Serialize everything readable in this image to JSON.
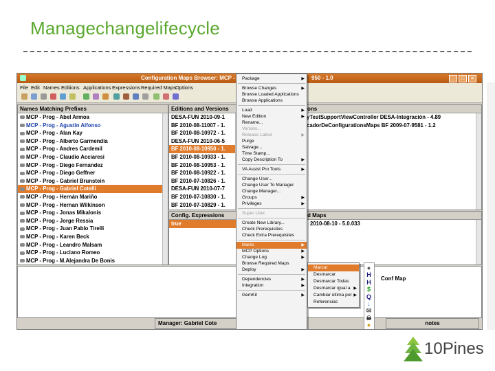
{
  "slide": {
    "title": "Managechangelifecycle"
  },
  "window": {
    "title_left": "Configuration Maps Browser: MCP - Pro",
    "title_right": "950 - 1.0",
    "controls": [
      "_",
      "□",
      "×"
    ]
  },
  "menubar": [
    "File",
    "Edit",
    "Names",
    "Editions",
    "Applications",
    "Expressions",
    "Required Maps",
    "Options"
  ],
  "names_pane": {
    "header": "Names Matching Prefixes",
    "rows": [
      "MCP - Prog - Abel Armoa",
      "MCP - Prog - Agustin Alfonso",
      "MCP - Prog - Alan Kay",
      "MCP - Prog - Alberto Garmendia",
      "MCP - Prog - Andres Cardemil",
      "MCP - Prog - Claudio Acciaresi",
      "MCP - Prog - Diego Fernandez",
      "MCP - Prog - Diego Geffner",
      "MCP - Prog - Gabriel Brunstein",
      "MCP - Prog - Gabriel Cotelli",
      "MCP - Prog - Hernán Mariño",
      "MCP - Prog - Hernan Wilkinson",
      "MCP - Prog - Jonas Mikalonis",
      "MCP - Prog - Jorge Ressia",
      "MCP - Prog - Juan Pablo Tirelli",
      "MCP - Prog - Karen Beck",
      "MCP - Prog - Leandro Malsam",
      "MCP - Prog - Luciano Romeo",
      "MCP - Prog - M.Alejandra De Bonis"
    ],
    "selected_index": 9,
    "blue_index": 1
  },
  "editions_pane": {
    "header": "Editions and Versions",
    "rows": [
      "DESA-FUN 2010-09-1",
      "BF 2010-08-11007 - 1.",
      "BF 2010-08-10972 - 1.",
      "DESA-FUN 2010-06-5",
      "BF 2010-08-10950 - 1.",
      "BF 2010-08-10933 - 1.",
      "BF 2010-08-10953 - 1.",
      "BF 2010-08-10922 - 1.",
      "BF 2010-07-10826 - 1.",
      "DESA-FUN 2010-07-7",
      "BF 2010-07-10830 - 1.",
      "BF 2010-07-10829 - 1."
    ],
    "selected_index": 4
  },
  "config_pane": {
    "header": "Config. Expressions",
    "rows": [
      "true"
    ]
  },
  "apps_pane": {
    "header": "ons",
    "rows": [
      "ryTestSupportViewController DESA-Integración - 4.89",
      "rcadorDeConfigurationsMaps BF 2009-07-9581 - 1.2"
    ]
  },
  "req_pane": {
    "header": "d Maps",
    "rows": [
      "2010-08-10 - 5.0.033"
    ]
  },
  "lower_pane": {
    "text": "Conf Map"
  },
  "status": {
    "manager": "Manager: Gabriel Cote",
    "notes": "notes"
  },
  "context_menu": [
    {
      "label": "Package",
      "arrow": true
    },
    {
      "sep": true
    },
    {
      "label": "Browse Changes",
      "arrow": true
    },
    {
      "label": "Browse Loaded Applications"
    },
    {
      "label": "Browse Applications"
    },
    {
      "sep": true
    },
    {
      "label": "Load",
      "arrow": true
    },
    {
      "label": "New Edition",
      "arrow": true
    },
    {
      "label": "Rename..."
    },
    {
      "label": "Version...",
      "disabled": true
    },
    {
      "label": "Release Latest",
      "arrow": true,
      "disabled": true
    },
    {
      "label": "Purge"
    },
    {
      "label": "Salvage..."
    },
    {
      "label": "Time Stamp..."
    },
    {
      "label": "Copy Description To",
      "arrow": true
    },
    {
      "sep": true
    },
    {
      "label": "VA Assist Pro Tools",
      "arrow": true
    },
    {
      "sep": true
    },
    {
      "label": "Change User..."
    },
    {
      "label": "Change User To Manager"
    },
    {
      "label": "Change Manager..."
    },
    {
      "label": "Groups",
      "arrow": true
    },
    {
      "label": "Privileges",
      "arrow": true
    },
    {
      "sep": true
    },
    {
      "label": "Super User",
      "disabled": true
    },
    {
      "sep": true
    },
    {
      "label": "Create New Library..."
    },
    {
      "label": "Check Prerequisites"
    },
    {
      "label": "Check Extra Prerequisites"
    },
    {
      "sep": true
    },
    {
      "label": "Marks",
      "arrow": true,
      "highlight": true
    },
    {
      "label": "MCP Options",
      "arrow": true
    },
    {
      "label": "Change Log",
      "arrow": true
    },
    {
      "label": "Browse Required Maps"
    },
    {
      "label": "Deploy",
      "arrow": true
    },
    {
      "sep": true
    },
    {
      "label": "Dependencies",
      "arrow": true
    },
    {
      "label": "Integration",
      "arrow": true
    },
    {
      "sep": true
    },
    {
      "label": "GemKit",
      "arrow": true
    }
  ],
  "marks_menu": [
    {
      "label": "Marcar",
      "highlight": true
    },
    {
      "label": "Desmarcar"
    },
    {
      "label": "Desmarcar Todas"
    },
    {
      "label": "Desmarcar igual a",
      "arrow": true
    },
    {
      "label": "Cambiar última por",
      "arrow": true
    },
    {
      "label": "Referencias"
    }
  ],
  "mark_icons": [
    "●",
    "H",
    "H",
    "$",
    "Q",
    "↓",
    "✉",
    "☠",
    "●"
  ],
  "logo": {
    "text": "10Pines",
    "dots": "• • • • • •"
  }
}
